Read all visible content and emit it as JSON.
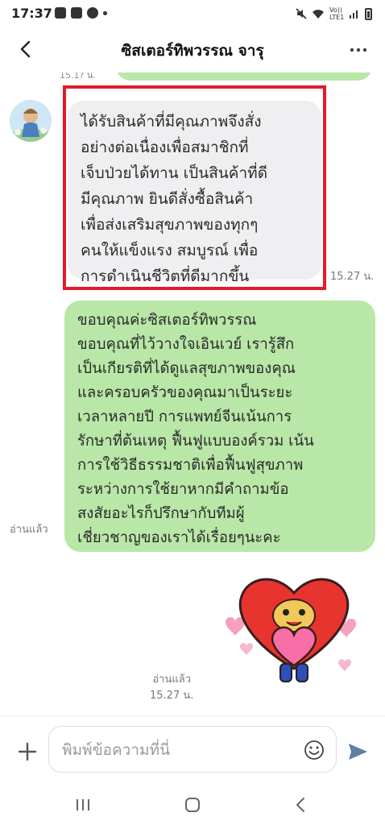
{
  "status_bar": {
    "time": "17:37",
    "network_label": "Vo)) LTE1"
  },
  "header": {
    "title": "ซิสเตอร์ทิพวรรณ จารุ",
    "back_icon": "chevron-left-icon",
    "more_icon": "more-horizontal-icon"
  },
  "chat": {
    "previous_time_fragment": "15.1? น.",
    "incoming_message": {
      "text": "ได้รับสินค้าที่มีคุณภาพจึงสั่ง\nอย่างต่อเนื่องเพื่อสมาชิกที่\nเจ็บป่วยได้ทาน เป็นสินค้าที่ดี\nมีคุณภาพ ยินดีสั่งซื้อสินค้า\nเพื่อส่งเสริมสุขภาพของทุกๆ\nคนให้แข็งแรง สมบูรณ์ เพื่อ\nการดำเนินชีวิตที่ดีมากขึ้น",
      "time": "15.27 น.",
      "highlight_color": "#e11c2a"
    },
    "outgoing_message": {
      "text": "ขอบคุณค่ะซิสเตอร์ทิพวรรณ\nขอบคุณที่ไว้วางใจเอินเวย์ เรารู้สึก\nเป็นเกียรติที่ได้ดูแลสุขภาพของคุณ\nและครอบครัวของคุณมาเป็นระยะ\nเวลาหลายปี การแพทย์จีนเน้นการ\nรักษาที่ต้นเหตุ ฟื้นฟูแบบองค์รวม เน้น\nการใช้วิธีธรรมชาติเพื่อฟื้นฟูสุขภาพ\nระหว่างการใช้ยาหากมีคำถามข้อ\nสงสัยอะไรก็ปรึกษากับทีมผู้\nเชี่ยวชาญของเราได้เรื่อยๆนะคะ",
      "read_status": "อ่านแล้ว"
    },
    "sticker": {
      "icon": "heart-character-sticker",
      "read_status": "อ่านแล้ว",
      "time": "15.27 น."
    }
  },
  "input_bar": {
    "placeholder": "พิมพ์ข้อความที่นี่",
    "plus_icon": "plus-icon",
    "emoji_icon": "smiley-icon",
    "send_icon": "send-icon"
  },
  "nav_bar": {
    "recent_icon": "recent-apps-icon",
    "home_icon": "home-icon",
    "back_icon": "nav-back-icon"
  },
  "colors": {
    "outgoing_bubble": "#b9e7a7",
    "incoming_bubble": "#efeff1",
    "send_icon": "#5f7fa5"
  }
}
